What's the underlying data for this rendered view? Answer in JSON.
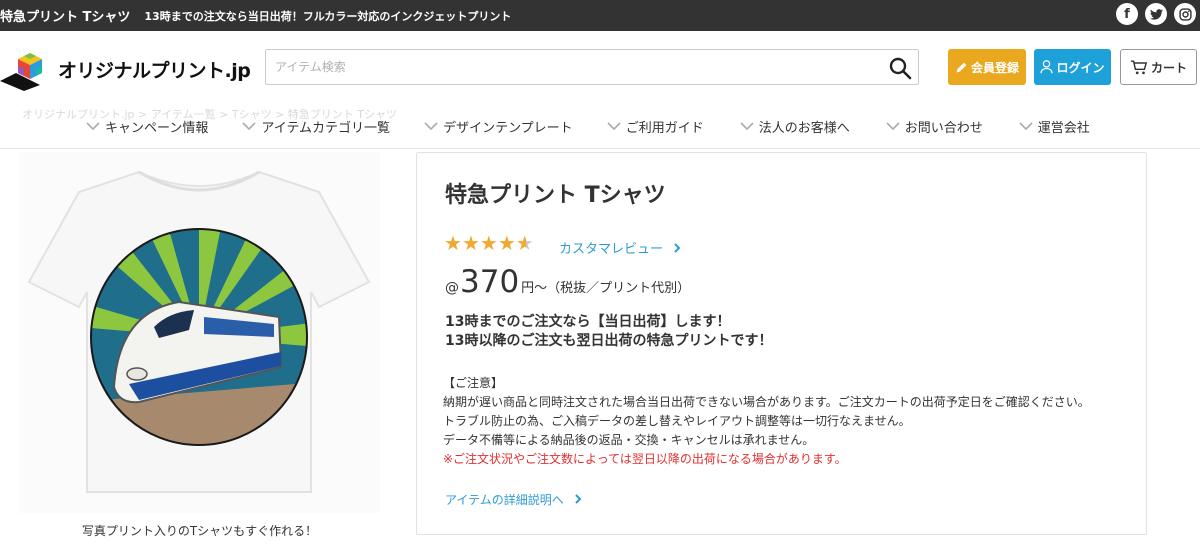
{
  "topbar": {
    "title": "特急プリント Tシャツ",
    "tagline": "13時までの注文なら当日出荷！フルカラー対応のインクジェットプリント",
    "social_icons": [
      "facebook-icon",
      "twitter-icon",
      "instagram-icon"
    ]
  },
  "header": {
    "logo_text": "オリジナルプリント.jp",
    "search_placeholder": "アイテム検索",
    "register_label": "会員登録",
    "login_label": "ログイン",
    "cart_label": "カート",
    "colors": {
      "register": "#e9a81d",
      "login": "#1da1d8"
    }
  },
  "nav": {
    "breadcrumb_ghost": "オリジナルプリント.jp > アイテム一覧 > Tシャツ > 特急プリント Tシャツ",
    "items": [
      {
        "label": "キャンペーン情報"
      },
      {
        "label": "アイテムカテゴリ一覧"
      },
      {
        "label": "デザインテンプレート"
      },
      {
        "label": "ご利用ガイド"
      },
      {
        "label": "法人のお客様へ"
      },
      {
        "label": "お問い合わせ"
      },
      {
        "label": "運営会社"
      }
    ]
  },
  "product": {
    "image_caption": "写真プリント入りのTシャツもすぐ作れる！",
    "title": "特急プリント Tシャツ",
    "rating": 4.5,
    "review_link": "カスタマレビュー",
    "price_prefix": "@",
    "price": "370",
    "price_suffix": "円～（税抜／プリント代別）",
    "headline_1": "13時までのご注文なら【当日出荷】します！",
    "headline_2": "13時以降のご注文も翌日出荷の特急プリントです！",
    "notice_title": "【ご注意】",
    "notice_1": "納期が遅い商品と同時注文された場合当日出荷できない場合があります。ご注文カートの出荷予定日をご確認ください。",
    "notice_2": "トラブル防止の為、ご入稿データの差し替えやレイアウト調整等は一切行なえません。",
    "notice_3": "データ不備等による納品後の返品・交換・キャンセルは承れません。",
    "notice_red": "※ご注文状況やご注文数によっては翌日以降の出荷になる場合があります。",
    "detail_link": "アイテムの詳細説明へ",
    "colors": {
      "star": "#f2a92f",
      "link": "#2d9bd2",
      "warning": "#e03030"
    }
  }
}
